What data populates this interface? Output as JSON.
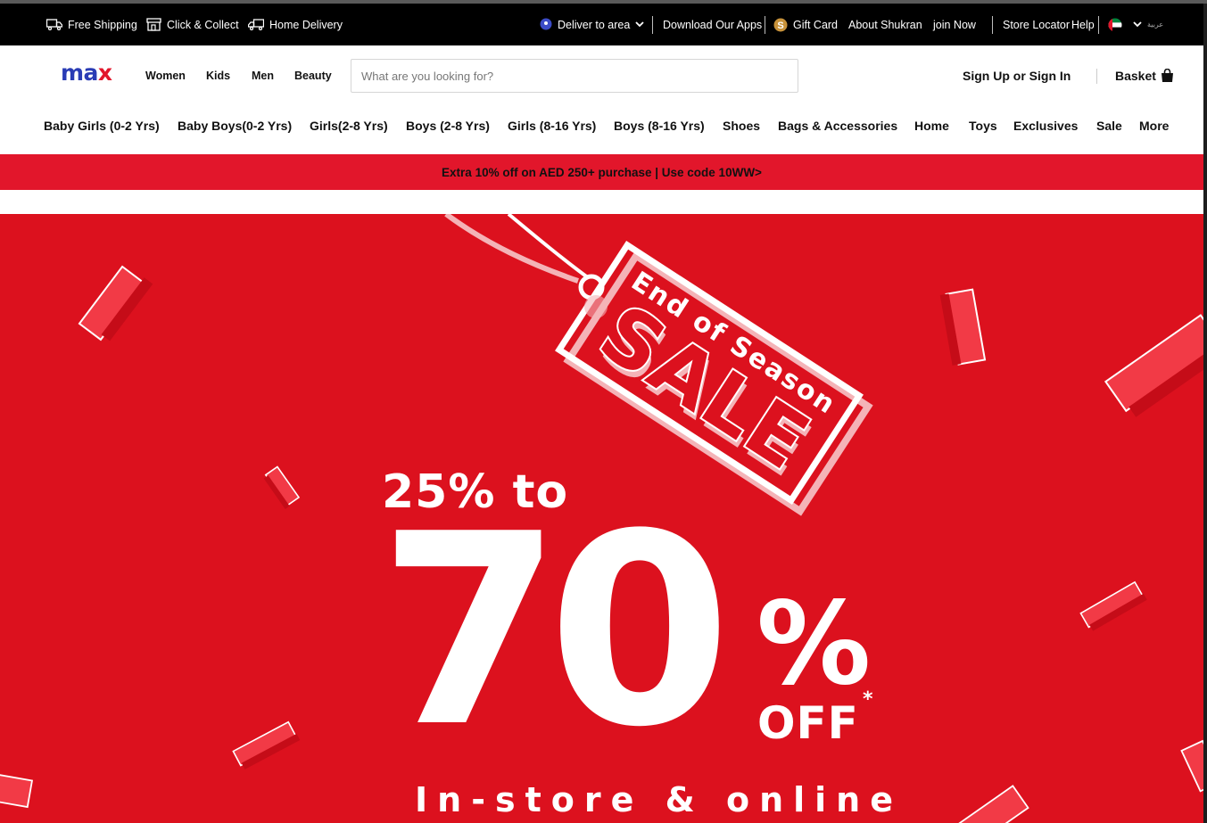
{
  "utility_bar": {
    "free_shipping": "Free Shipping",
    "click_collect": "Click & Collect",
    "home_delivery": "Home Delivery",
    "deliver_to_area": "Deliver to area",
    "download_apps": "Download Our Apps",
    "gift_card": "Gift Card",
    "about_shukran": "About Shukran",
    "join_now": "join Now",
    "store_locator": "Store Locator",
    "help": "Help",
    "language": "عربية"
  },
  "header": {
    "logo_m": "ma",
    "logo_x": "x",
    "departments": [
      "Women",
      "Kids",
      "Men",
      "Beauty"
    ],
    "search_placeholder": "What are you looking for?",
    "signin": "Sign Up or Sign In",
    "basket": "Basket"
  },
  "category_nav": [
    "Baby Girls (0-2 Yrs)",
    "Baby Boys(0-2 Yrs)",
    "Girls(2-8 Yrs)",
    "Boys (2-8 Yrs)",
    "Girls (8-16 Yrs)",
    "Boys (8-16 Yrs)",
    "Shoes",
    "Bags & Accessories",
    "Home",
    "Toys",
    "Exclusives",
    "Sale",
    "More"
  ],
  "promo_banner": "Extra 10% off on AED 250+ purchase | Use code 10WW>",
  "hero": {
    "tag_line1": "End of Season",
    "tag_line2": "SALE",
    "range_text": "25% to",
    "big_number": "70",
    "percent": "%",
    "asterisk": "*",
    "off": "OFF",
    "channels": "In-store & online"
  },
  "colors": {
    "brand_blue": "#2a3cb5",
    "brand_red": "#e2162b",
    "hero_red": "#dc111e",
    "utility_bg": "#000000"
  }
}
